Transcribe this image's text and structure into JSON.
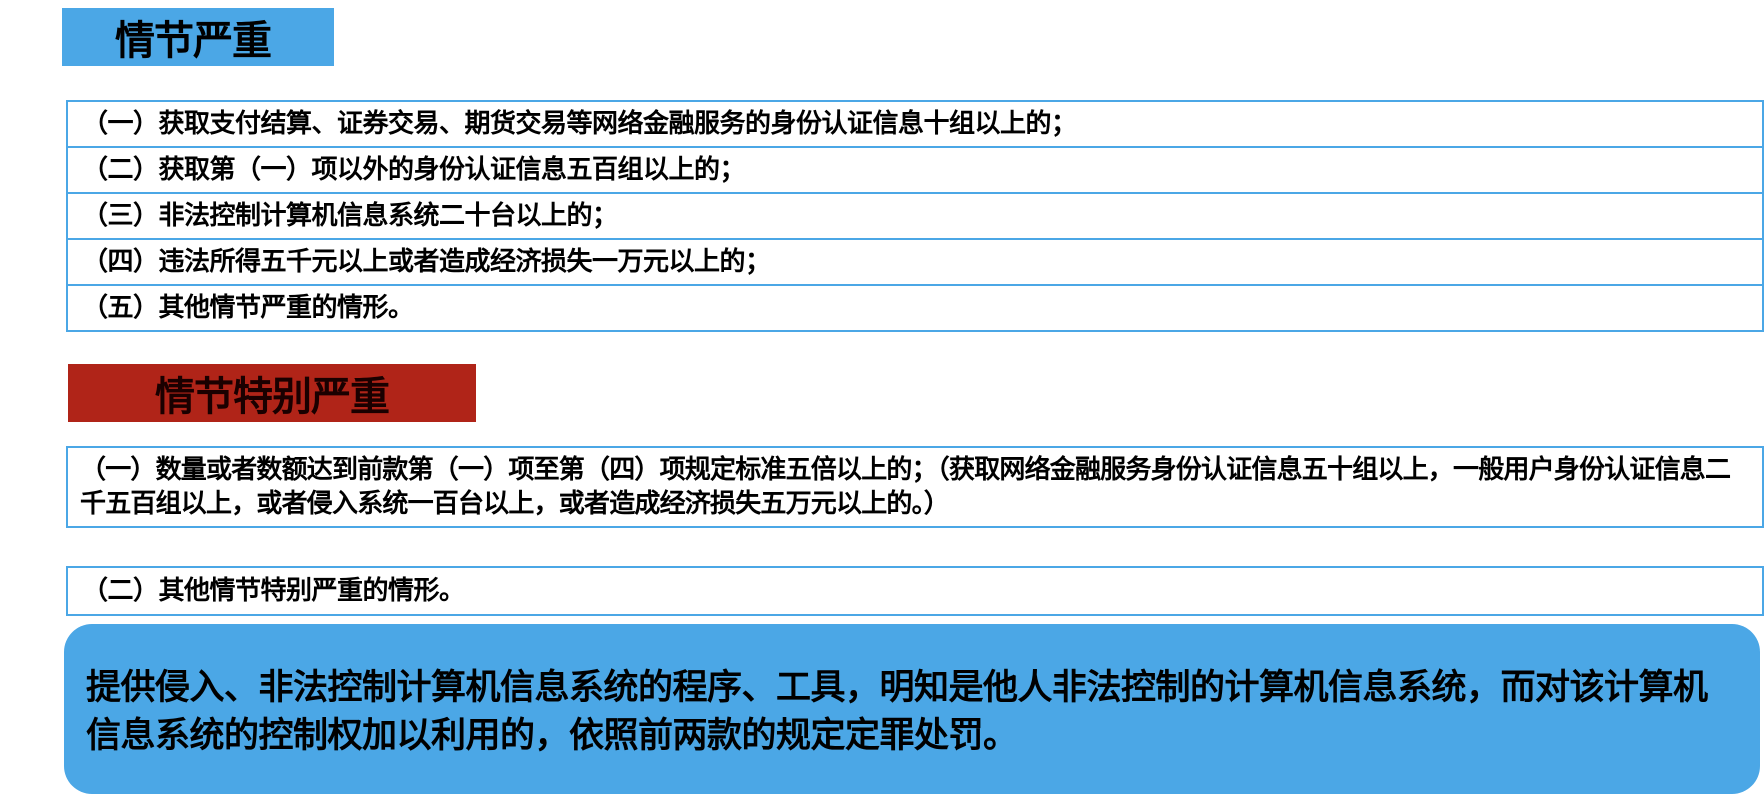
{
  "section_serious": {
    "title": "情节严重",
    "items": [
      "（一）获取支付结算、证券交易、期货交易等网络金融服务的身份认证信息十组以上的；",
      "（二）获取第（一）项以外的身份认证信息五百组以上的；",
      "（三）非法控制计算机信息系统二十台以上的；",
      "（四）违法所得五千元以上或者造成经济损失一万元以上的；",
      "（五）其他情节严重的情形。"
    ]
  },
  "section_very_serious": {
    "title": "情节特别严重",
    "items": [
      "（一）数量或者数额达到前款第（一）项至第（四）项规定标准五倍以上的；（获取网络金融服务身份认证信息五十组以上，一般用户身份认证信息二千五百组以上，或者侵入系统一百台以上，或者造成经济损失五万元以上的。）",
      "（二）其他情节特别严重的情形。"
    ]
  },
  "callout": {
    "text": "提供侵入、非法控制计算机信息系统的程序、工具，明知是他人非法控制的计算机信息系统，而对该计算机信息系统的控制权加以利用的，依照前两款的规定定罪处罚。"
  },
  "colors": {
    "accent_blue": "#4ba7e6",
    "accent_red": "#b02418"
  }
}
